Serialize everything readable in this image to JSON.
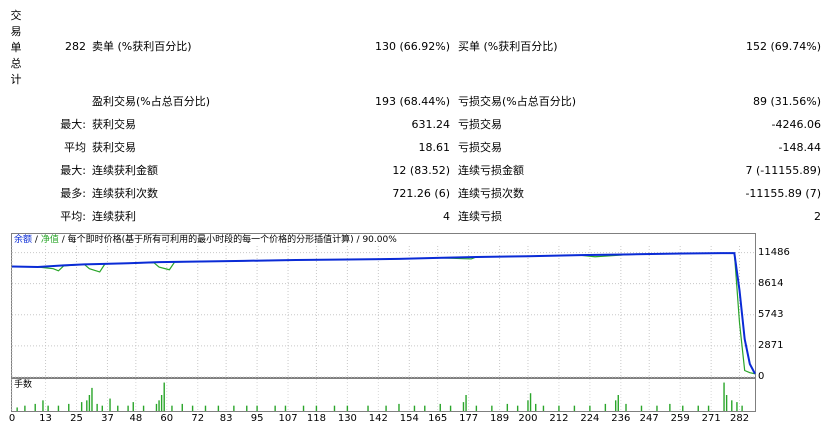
{
  "side_label": [
    "交",
    "易",
    "单",
    "总",
    "计"
  ],
  "summary": {
    "total_trades": "282",
    "short_label": "卖单 (%获利百分比)",
    "short_value": "130 (66.92%)",
    "long_label": "买单 (%获利百分比)",
    "long_value": "152 (69.74%)"
  },
  "rows": [
    {
      "prefix": "",
      "l_label": "盈利交易(%占总百分比)",
      "l_value": "193 (68.44%)",
      "r_label": "亏损交易(%占总百分比)",
      "r_value": "89 (31.56%)"
    },
    {
      "prefix": "最大:",
      "l_label": "获利交易",
      "l_value": "631.24",
      "r_label": "亏损交易",
      "r_value": "-4246.06"
    },
    {
      "prefix": "平均",
      "l_label": "获利交易",
      "l_value": "18.61",
      "r_label": "亏损交易",
      "r_value": "-148.44"
    },
    {
      "prefix": "最大:",
      "l_label": "连续获利金额",
      "l_value": "12 (83.52)",
      "r_label": "连续亏损金额",
      "r_value": "7 (-11155.89)"
    },
    {
      "prefix": "最多:",
      "l_label": "连续获利次数",
      "l_value": "721.26 (6)",
      "r_label": "连续亏损次数",
      "r_value": "-11155.89 (7)"
    },
    {
      "prefix": "平均:",
      "l_label": "连续获利",
      "l_value": "4",
      "r_label": "连续亏损",
      "r_value": "2"
    }
  ],
  "chart_legend": {
    "balance": "余额",
    "equity": "净值",
    "desc": "每个即时价格(基于所有可利用的最小时段的每一个价格的分形插值计算)",
    "quality": "90.00%"
  },
  "volume_legend": "手数",
  "colors": {
    "balance": "#0a2bd6",
    "equity": "#2aa52a",
    "volume": "#2aa52a"
  },
  "chart_data": {
    "type": "line",
    "x_ticks": [
      0,
      13,
      25,
      37,
      48,
      60,
      72,
      83,
      95,
      107,
      118,
      130,
      142,
      154,
      165,
      177,
      189,
      200,
      212,
      224,
      236,
      247,
      259,
      271,
      282
    ],
    "y_ticks": [
      0,
      2871,
      5743,
      8614,
      11486
    ],
    "ylim": [
      0,
      13200
    ],
    "xlim": [
      0,
      288
    ],
    "series": [
      {
        "key": "balance",
        "points": [
          [
            0,
            10200
          ],
          [
            10,
            10150
          ],
          [
            20,
            10300
          ],
          [
            28,
            10400
          ],
          [
            34,
            10430
          ],
          [
            45,
            10500
          ],
          [
            57,
            10600
          ],
          [
            70,
            10650
          ],
          [
            90,
            10720
          ],
          [
            110,
            10800
          ],
          [
            130,
            10850
          ],
          [
            150,
            10900
          ],
          [
            165,
            11000
          ],
          [
            180,
            11080
          ],
          [
            200,
            11150
          ],
          [
            220,
            11250
          ],
          [
            240,
            11320
          ],
          [
            260,
            11400
          ],
          [
            275,
            11440
          ],
          [
            280,
            11430
          ],
          [
            282,
            8000
          ],
          [
            284,
            3500
          ],
          [
            286,
            1200
          ],
          [
            288,
            300
          ]
        ]
      },
      {
        "key": "equity",
        "points": [
          [
            0,
            10200
          ],
          [
            10,
            10150
          ],
          [
            16,
            10000
          ],
          [
            18,
            9800
          ],
          [
            20,
            10250
          ],
          [
            28,
            10400
          ],
          [
            30,
            10000
          ],
          [
            34,
            9700
          ],
          [
            36,
            10430
          ],
          [
            45,
            10500
          ],
          [
            55,
            10550
          ],
          [
            57,
            10150
          ],
          [
            61,
            9900
          ],
          [
            63,
            10600
          ],
          [
            70,
            10650
          ],
          [
            90,
            10720
          ],
          [
            110,
            10800
          ],
          [
            130,
            10850
          ],
          [
            150,
            10900
          ],
          [
            165,
            11000
          ],
          [
            178,
            10900
          ],
          [
            180,
            11080
          ],
          [
            200,
            11150
          ],
          [
            220,
            11250
          ],
          [
            226,
            11100
          ],
          [
            240,
            11320
          ],
          [
            260,
            11400
          ],
          [
            275,
            11440
          ],
          [
            280,
            11430
          ],
          [
            282,
            5000
          ],
          [
            284,
            600
          ],
          [
            286,
            400
          ],
          [
            288,
            300
          ]
        ]
      }
    ],
    "volume": [
      [
        2,
        0.2
      ],
      [
        5,
        0.3
      ],
      [
        9,
        0.4
      ],
      [
        12,
        0.6
      ],
      [
        14,
        0.3
      ],
      [
        18,
        0.3
      ],
      [
        22,
        0.4
      ],
      [
        27,
        0.5
      ],
      [
        29,
        0.6
      ],
      [
        30,
        0.9
      ],
      [
        31,
        1.3
      ],
      [
        33,
        0.4
      ],
      [
        35,
        0.3
      ],
      [
        38,
        0.7
      ],
      [
        41,
        0.3
      ],
      [
        45,
        0.3
      ],
      [
        47,
        0.5
      ],
      [
        51,
        0.3
      ],
      [
        56,
        0.4
      ],
      [
        57,
        0.6
      ],
      [
        58,
        0.9
      ],
      [
        59,
        1.6
      ],
      [
        62,
        0.3
      ],
      [
        66,
        0.4
      ],
      [
        70,
        0.3
      ],
      [
        75,
        0.3
      ],
      [
        80,
        0.3
      ],
      [
        86,
        0.3
      ],
      [
        91,
        0.3
      ],
      [
        95,
        0.3
      ],
      [
        102,
        0.3
      ],
      [
        106,
        0.3
      ],
      [
        113,
        0.3
      ],
      [
        118,
        0.3
      ],
      [
        125,
        0.3
      ],
      [
        130,
        0.3
      ],
      [
        138,
        0.3
      ],
      [
        145,
        0.3
      ],
      [
        150,
        0.4
      ],
      [
        156,
        0.3
      ],
      [
        160,
        0.3
      ],
      [
        166,
        0.4
      ],
      [
        170,
        0.3
      ],
      [
        175,
        0.5
      ],
      [
        176,
        0.9
      ],
      [
        180,
        0.3
      ],
      [
        186,
        0.3
      ],
      [
        192,
        0.4
      ],
      [
        196,
        0.3
      ],
      [
        200,
        0.6
      ],
      [
        201,
        1.0
      ],
      [
        203,
        0.4
      ],
      [
        206,
        0.3
      ],
      [
        212,
        0.3
      ],
      [
        218,
        0.3
      ],
      [
        224,
        0.3
      ],
      [
        230,
        0.4
      ],
      [
        234,
        0.6
      ],
      [
        235,
        0.9
      ],
      [
        238,
        0.4
      ],
      [
        244,
        0.3
      ],
      [
        250,
        0.3
      ],
      [
        255,
        0.4
      ],
      [
        260,
        0.3
      ],
      [
        266,
        0.3
      ],
      [
        270,
        0.3
      ],
      [
        276,
        1.6
      ],
      [
        277,
        0.9
      ],
      [
        279,
        0.6
      ],
      [
        281,
        0.5
      ],
      [
        283,
        0.3
      ]
    ]
  }
}
